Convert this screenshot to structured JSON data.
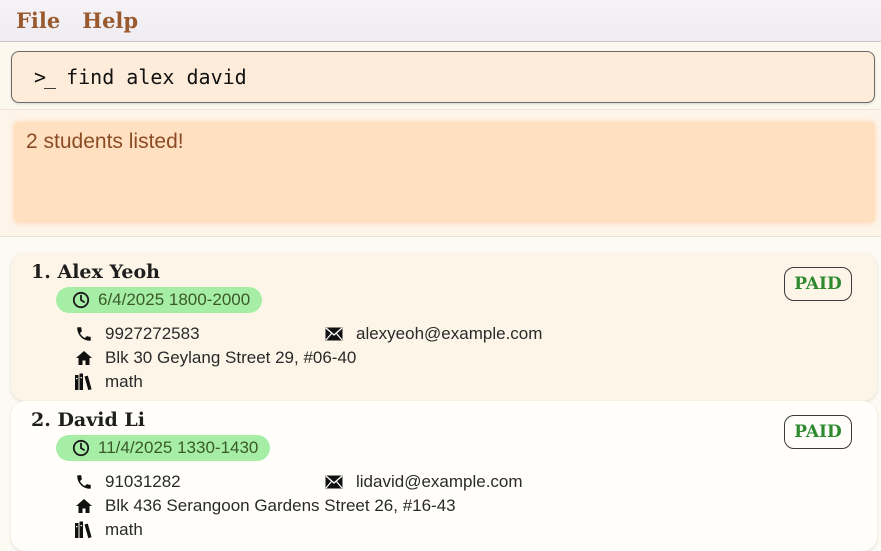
{
  "menu": {
    "file": "File",
    "help": "Help"
  },
  "command": {
    "prompt": ">_",
    "value": "find alex david"
  },
  "result": {
    "message": "2 students listed!"
  },
  "students": [
    {
      "name": "1. Alex Yeoh",
      "schedule": "6/4/2025 1800-2000",
      "status": "PAID",
      "phone": "9927272583",
      "email": "alexyeoh@example.com",
      "address": "Blk 30 Geylang Street 29, #06-40",
      "subject": "math"
    },
    {
      "name": "2. David Li",
      "schedule": "11/4/2025 1330-1430",
      "status": "PAID",
      "phone": "91031282",
      "email": "lidavid@example.com",
      "address": "Blk 436 Serangoon Gardens Street 26, #16-43",
      "subject": "math"
    }
  ],
  "colors": {
    "accent": "#9a5a2f",
    "paid": "#2f8a2f",
    "schedule_bg": "#a6eea6",
    "result_bg": "#ffe1c2"
  },
  "icons": [
    "clock-icon",
    "phone-icon",
    "mail-icon",
    "home-icon",
    "books-icon"
  ]
}
